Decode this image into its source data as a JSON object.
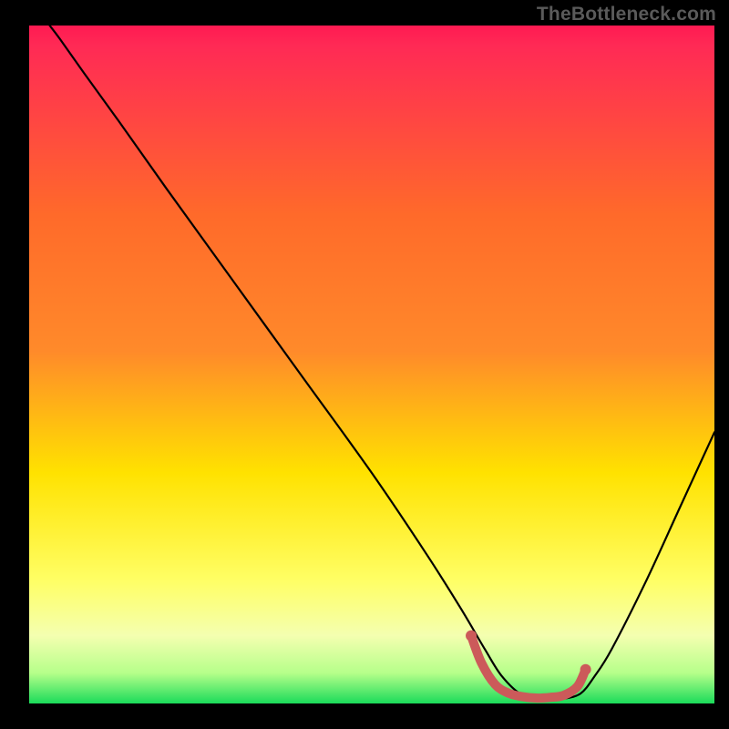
{
  "watermark": "TheBottleneck.com",
  "chart_data": {
    "type": "line",
    "title": "",
    "xlabel": "",
    "ylabel": "",
    "xlim": [
      0,
      100
    ],
    "ylim": [
      0,
      100
    ],
    "legend": false,
    "grid": false,
    "background_gradient": {
      "top": "#ff1a52",
      "mid1": "#ff8a2a",
      "mid2": "#ffe200",
      "mid3": "#ffff66",
      "bottom": "#1bdb5a"
    },
    "series": [
      {
        "name": "bottleneck-curve",
        "color": "#000000",
        "x": [
          3,
          4.5,
          8,
          13,
          20,
          30,
          40,
          50,
          58,
          63,
          66.5,
          69,
          72,
          75,
          78,
          80.5,
          82.5,
          85,
          90,
          95,
          100
        ],
        "y": [
          100,
          98,
          93,
          86,
          76,
          62,
          48,
          34,
          22,
          14,
          8,
          4,
          1.2,
          0.6,
          0.7,
          1.5,
          4,
          8,
          18,
          29,
          40
        ]
      },
      {
        "name": "optimal-zone",
        "color": "#cc5a5a",
        "thick": true,
        "x": [
          64.5,
          66,
          68,
          70,
          72,
          74,
          76,
          78,
          80,
          81.2
        ],
        "y": [
          10,
          6,
          2.8,
          1.5,
          1.0,
          0.8,
          0.9,
          1.2,
          2.5,
          5
        ]
      }
    ],
    "annotations": []
  }
}
